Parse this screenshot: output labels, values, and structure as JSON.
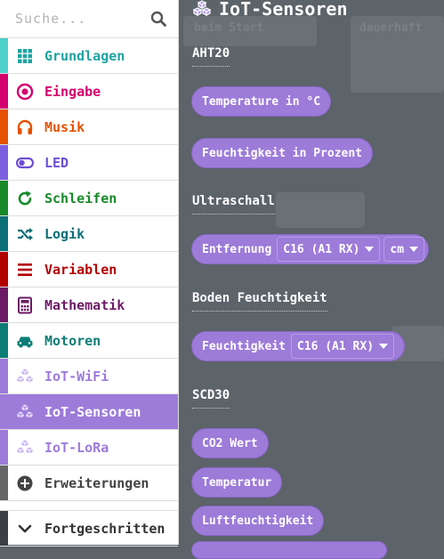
{
  "search": {
    "placeholder": "Suche..."
  },
  "categories": [
    {
      "label": "Grundlagen",
      "color": "#1fa3a0",
      "bar": "#4dd0c9",
      "icon": "grid-icon"
    },
    {
      "label": "Eingabe",
      "color": "#d4006e",
      "bar": "#d4006e",
      "icon": "circle-dot-icon"
    },
    {
      "label": "Musik",
      "color": "#e65100",
      "bar": "#e65100",
      "icon": "headphones-icon"
    },
    {
      "label": "LED",
      "color": "#6c4fd6",
      "bar": "#7c5fe0",
      "icon": "toggle-icon"
    },
    {
      "label": "Schleifen",
      "color": "#188a2a",
      "bar": "#188a2a",
      "icon": "refresh-icon"
    },
    {
      "label": "Logik",
      "color": "#0a6f76",
      "bar": "#0a6f76",
      "icon": "shuffle-icon"
    },
    {
      "label": "Variablen",
      "color": "#b30000",
      "bar": "#b30000",
      "icon": "list-icon"
    },
    {
      "label": "Mathematik",
      "color": "#6b1b66",
      "bar": "#6b1b66",
      "icon": "calculator-icon"
    },
    {
      "label": "Motoren",
      "color": "#0b7d76",
      "bar": "#0b7d76",
      "icon": "car-icon"
    },
    {
      "label": "IoT-WiFi",
      "color": "#9d7bd9",
      "bar": "#9d7bd9",
      "icon": "cubes-icon"
    },
    {
      "label": "IoT-Sensoren",
      "color": "#ffffff",
      "bar": "#9d7bd9",
      "icon": "cubes-icon",
      "selected": true
    },
    {
      "label": "IoT-LoRa",
      "color": "#9d7bd9",
      "bar": "#9d7bd9",
      "icon": "cubes-icon"
    },
    {
      "label": "Erweiterungen",
      "color": "#444444",
      "bar": "#666666",
      "icon": "plus-circle-icon"
    }
  ],
  "advanced": {
    "label": "Fortgeschritten"
  },
  "workspace": {
    "ghost_label_1": "beim Start",
    "ghost_label_2": "dauerhaft"
  },
  "flyout": {
    "title": "IoT-Sensoren",
    "sections": {
      "aht20": "AHT20",
      "ultraschall": "Ultraschall",
      "boden": "Boden Feuchtigkeit",
      "scd30": "SCD30"
    },
    "blocks": {
      "temperature": "Temperature in °C",
      "feuchtigkeit_prozent": "Feuchtigkeit in Prozent",
      "entfernung": "Entfernung",
      "entfernung_pin": "C16 (A1 RX)",
      "entfernung_unit": "cm",
      "feuchtigkeit": "Feuchtigkeit",
      "feuchtigkeit_pin": "C16 (A1 RX)",
      "co2": "CO2 Wert",
      "temperatur": "Temperatur",
      "luftfeuchtigkeit": "Luftfeuchtigkeit"
    },
    "color": "#9d7bd9"
  }
}
